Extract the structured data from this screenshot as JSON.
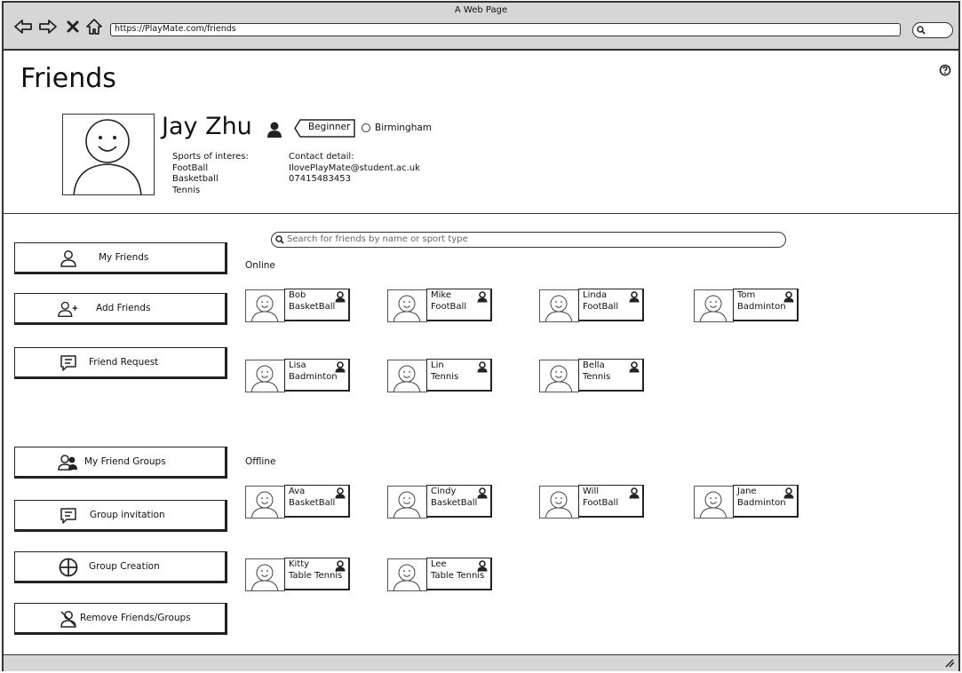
{
  "window": {
    "title": "A Web Page",
    "url": "https://PlayMate.com/friends"
  },
  "page": {
    "title": "Friends"
  },
  "profile": {
    "name": "Jay Zhu",
    "level": "Beginner",
    "location": "Birmingham",
    "sports_label": "Sports of interes:",
    "sports": [
      "FootBall",
      "Basketball",
      "Tennis"
    ],
    "contact_label": "Contact detail:",
    "email": "IlovePlayMate@student.ac.uk",
    "phone": "07415483453"
  },
  "sidebar": {
    "items": [
      {
        "label": "My Friends",
        "icon": "user-icon"
      },
      {
        "label": "Add Friends",
        "icon": "user-plus-icon"
      },
      {
        "label": "Friend Request",
        "icon": "message-icon"
      },
      {
        "label": "My Friend Groups",
        "icon": "users-icon"
      },
      {
        "label": "Group invitation",
        "icon": "message-icon"
      },
      {
        "label": "Group Creation",
        "icon": "plus-circle-icon"
      },
      {
        "label": "Remove Friends/Groups",
        "icon": "user-remove-icon"
      }
    ]
  },
  "search": {
    "placeholder": "Search for friends by name or sport type"
  },
  "online": {
    "label": "Online",
    "friends": [
      {
        "name": "Bob",
        "sport": "BasketBall"
      },
      {
        "name": "Mike",
        "sport": "FootBall"
      },
      {
        "name": "Linda",
        "sport": "FootBall"
      },
      {
        "name": "Tom",
        "sport": "Badminton"
      },
      {
        "name": "Lisa",
        "sport": "Badminton"
      },
      {
        "name": "Lin",
        "sport": "Tennis"
      },
      {
        "name": "Bella",
        "sport": "Tennis"
      }
    ]
  },
  "offline": {
    "label": "Offline",
    "friends": [
      {
        "name": "Ava",
        "sport": "BasketBall"
      },
      {
        "name": "Cindy",
        "sport": "BasketBall"
      },
      {
        "name": "Will",
        "sport": "FootBall"
      },
      {
        "name": "Jane",
        "sport": "Badminton"
      },
      {
        "name": "Kitty",
        "sport": "Table Tennis"
      },
      {
        "name": "Lee",
        "sport": "Table Tennis"
      }
    ]
  }
}
